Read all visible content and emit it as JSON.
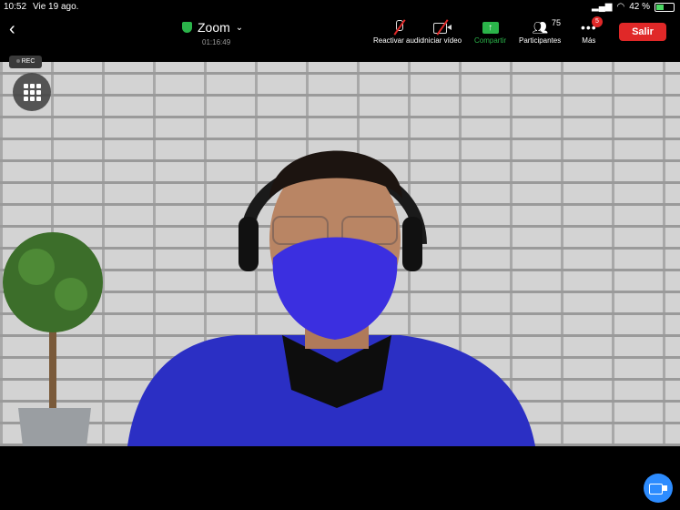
{
  "status_bar": {
    "time": "10:52",
    "date": "Vie 19 ago.",
    "battery_percent": "42 %",
    "battery_level": 0.42
  },
  "toolbar": {
    "app_title": "Zoom",
    "elapsed": "01:16:49",
    "buttons": {
      "audio": "Reactivar audio",
      "video": "Iniciar vídeo",
      "share": "Compartir",
      "participants": "Participantes",
      "more": "Más"
    },
    "participants_count": "75",
    "more_badge": "5",
    "leave": "Salir"
  },
  "overlay": {
    "rec": "REC"
  },
  "icons": [
    "back-chevron-icon",
    "shield-check-icon",
    "chevron-down-icon",
    "muted-mic-icon",
    "video-off-icon",
    "share-arrow-icon",
    "participants-icon",
    "more-dots-icon",
    "gallery-grid-icon",
    "video-camera-icon",
    "wifi-icon",
    "battery-icon"
  ],
  "colors": {
    "leave": "#e02828",
    "share": "#2bb44a",
    "fab": "#2d8cff",
    "toolbar": "#000000"
  }
}
